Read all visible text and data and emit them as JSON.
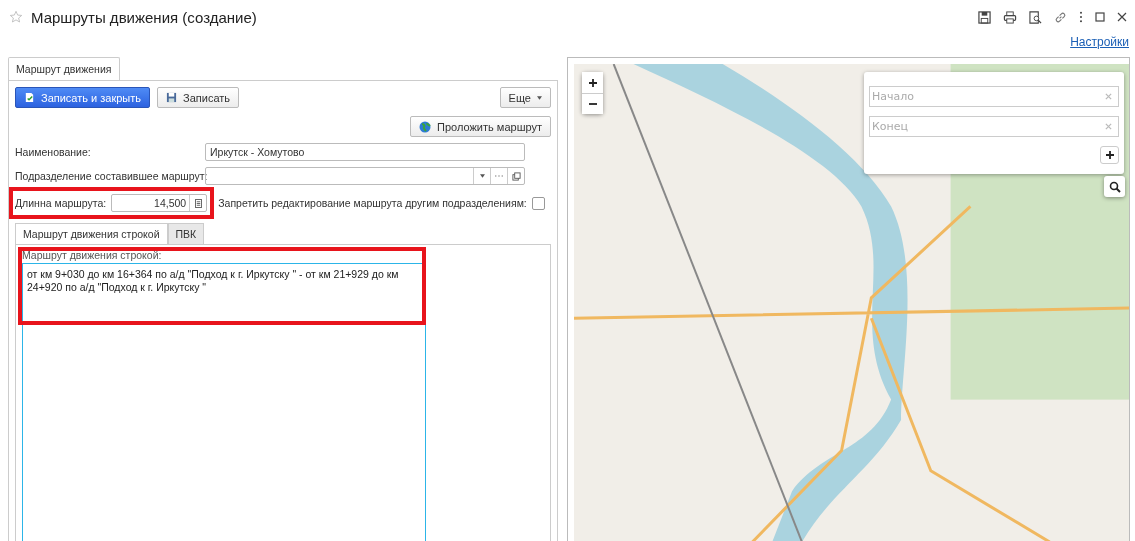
{
  "window": {
    "title": "Маршруты движения (создание)",
    "favorite": false
  },
  "header_link": "Настройки",
  "tabs": [
    {
      "label": "Маршрут движения",
      "selected": true
    }
  ],
  "toolbar": {
    "buttons": [
      {
        "label": "Записать и закрыть",
        "kind": "primary"
      },
      {
        "label": "Записать",
        "kind": "save"
      }
    ],
    "more": "Еще"
  },
  "route_button": "Проложить маршрут",
  "fields": {
    "name": {
      "label": "Наименование:",
      "value": "Иркутск - Хомутово"
    },
    "division": {
      "label": "Подразделение составившее маршрут:"
    },
    "length": {
      "label": "Длинна маршрута:",
      "value": "14,500"
    },
    "forbid": {
      "label": "Запретить редактирование маршрута другим подразделениям:",
      "checked": false
    }
  },
  "inner_tabs": [
    {
      "label": "Маршрут движения строкой",
      "selected": true
    },
    {
      "label": "ПВК",
      "selected": false
    }
  ],
  "route_text": {
    "label": "Маршрут движения строкой:",
    "lines": [
      "от км 9+030 до км 16+364 по а/д \"Подход к г. Иркутску \" -  от км 21+929 до км",
      "24+920 по а/д \"Подход к г. Иркутску \""
    ]
  },
  "map": {
    "start_placeholder": "Начало",
    "end_placeholder": "Конец"
  }
}
